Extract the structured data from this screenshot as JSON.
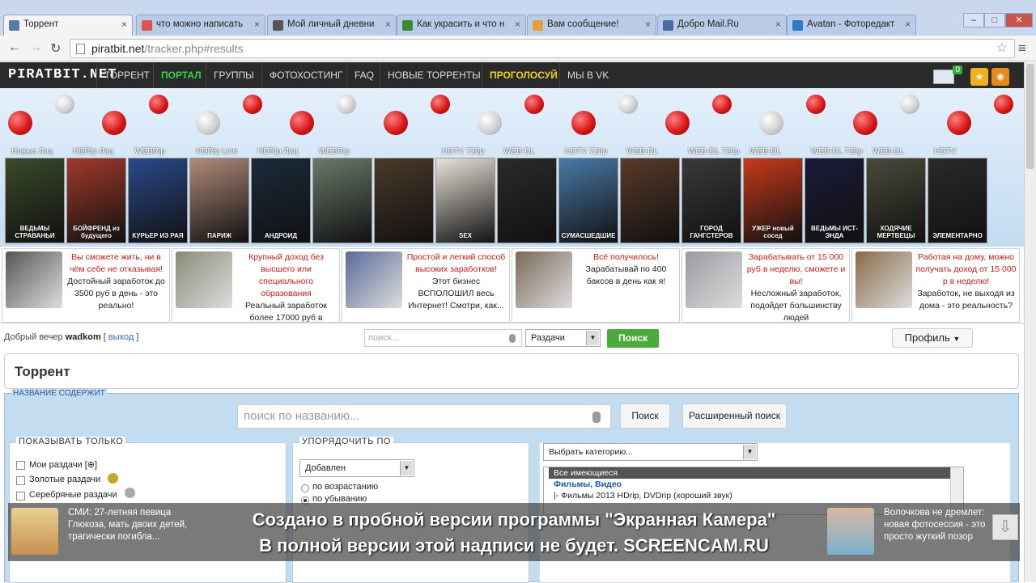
{
  "browser": {
    "tabs": [
      {
        "label": "Торрент",
        "active": true,
        "icon": "piratbit-icon"
      },
      {
        "label": "что можно написать",
        "icon": "yandex-icon"
      },
      {
        "label": "Мой личный дневни",
        "icon": "play-icon"
      },
      {
        "label": "Как украсить и что н",
        "icon": "puzzle-icon"
      },
      {
        "label": "Вам сообщение!",
        "icon": "mail-icon"
      },
      {
        "label": "Добро Mail.Ru",
        "icon": "shield-icon"
      },
      {
        "label": "Avatan - Фоторедакт",
        "icon": "avatan-icon"
      }
    ],
    "url_host": "piratbit.net",
    "url_path": "/tracker.php#results"
  },
  "site_nav": {
    "logo": "PIRATBIT.NET",
    "items": [
      {
        "label": "ТОРРЕНТ",
        "style": "normal"
      },
      {
        "label": "ПОРТАЛ",
        "style": "green"
      },
      {
        "label": "ГРУППЫ",
        "style": "normal"
      },
      {
        "label": "ФОТОХОСТИНГ",
        "style": "normal"
      },
      {
        "label": "FAQ",
        "style": "normal"
      },
      {
        "label": "НОВЫЕ ТОРРЕНТЫ",
        "style": "normal"
      },
      {
        "label": "ПРОГОЛОСУЙ",
        "style": "yellow"
      },
      {
        "label": "МЫ В VK",
        "style": "normal"
      }
    ],
    "mail_count": "0"
  },
  "posters": [
    {
      "label": "Новые Лиц",
      "title": "ВЕДЬМЫ СТРАВАНЬИ",
      "color": "#3a4a2a"
    },
    {
      "label": "HDRip Лиц",
      "title": "БОЙФРЕНД из будущего",
      "color": "#a03a2a"
    },
    {
      "label": "WEBRip",
      "title": "КУРЬЕР ИЗ РАЯ",
      "color": "#2a4a8a"
    },
    {
      "label": "HDRip Line",
      "title": "ПАРИЖ",
      "color": "#b08a7a"
    },
    {
      "label": "HDRip Лиц",
      "title": "АНДРОИД",
      "color": "#1a2a3a"
    },
    {
      "label": "WEBRip",
      "title": "",
      "color": "#6a7a6a"
    },
    {
      "label": "",
      "title": "",
      "color": "#4a3a2a"
    },
    {
      "label": "HDTV 720p",
      "title": "SEX",
      "color": "#e8e2d8"
    },
    {
      "label": "WEB-DL",
      "title": "",
      "color": "#2a2a2a"
    },
    {
      "label": "HDTV 720p",
      "title": "СУМАСШЕДШИЕ",
      "color": "#4a7aa8"
    },
    {
      "label": "WEB-DL",
      "title": "",
      "color": "#5a3a2a"
    },
    {
      "label": "WEB-DL 720p",
      "title": "ГОРОД ГАНГСТЕРОВ",
      "color": "#3a3a3a"
    },
    {
      "label": "WEB-DL",
      "title": "УЖЕР новый сосед",
      "color": "#c83a1a"
    },
    {
      "label": "WEB-DL 720p",
      "title": "ВЕДЬМЫ ИСТ-ЭНДА",
      "color": "#1a1a3a"
    },
    {
      "label": "WEB-DL",
      "title": "ХОДЯЧИЕ МЕРТВЕЦЫ",
      "color": "#4a4a3a"
    },
    {
      "label": "HDTV",
      "title": "ЭЛЕМЕНТАРНО",
      "color": "#2a2a2a"
    }
  ],
  "ads": [
    {
      "headline": "Вы сможете жить, ни в чём себе не отказывая!",
      "body": "Достойный заработок до 3500 руб в день - это реально!",
      "color": "#555"
    },
    {
      "headline": "Крупный доход без высшего или специального образования",
      "body": "Реальный заработок более 17000 руб в неделю!",
      "color": "#8a8a7a"
    },
    {
      "headline": "Простой и легкий способ высоких заработков!",
      "body": "Этот бизнес ВСПОЛОШИЛ весь Интернет! Смотри, как...",
      "color": "#5a6a9a"
    },
    {
      "headline": "Всё получилось!",
      "body": "Зарабатывай по 400 баксов в день как я!",
      "color": "#7a6a5a"
    },
    {
      "headline": "Зарабатывать от 15 000 руб в неделю, сможете и вы!",
      "body": "Несложный заработок, подойдет большинству людей",
      "color": "#9a9aa0"
    },
    {
      "headline": "Работая на дому, можно получать доход от 15 000 р в неделю!",
      "body": "Заработок, не выходя из дома - это реальность?",
      "color": "#8a6a4a"
    }
  ],
  "userbar": {
    "greeting": "Добрый вечер",
    "username": "wadkom",
    "logout": "выход",
    "search_placeholder": "поиск...",
    "select_value": "Раздачи",
    "search_button": "Поиск",
    "profile_button": "Профиль"
  },
  "torrent": {
    "title": "Торрент",
    "name_legend": "НАЗВАНИЕ СОДЕРЖИТ",
    "name_placeholder": "поиск по названию...",
    "search_button": "Поиск",
    "advanced_button": "Расширенный поиск",
    "show_only": {
      "legend": "ПОКАЗЫВАТЬ ТОЛЬКО",
      "options": [
        "Мои раздачи [⊕]",
        "Золотые раздачи",
        "Серебряные раздачи"
      ]
    },
    "sort": {
      "legend": "УПОРЯДОЧИТЬ ПО",
      "select_value": "Добавлен",
      "options": [
        "по возрастанию",
        "по убыванию"
      ],
      "selected": "по убыванию"
    },
    "category": {
      "select_value": "Выбрать категорию...",
      "list": [
        {
          "text": "Все имеющиеся",
          "kind": "hdr"
        },
        {
          "text": "Фильмы, Видео",
          "kind": "grp"
        },
        {
          "text": "|- Фильмы 2013 HDrip, DVDrip (хороший звук)",
          "kind": "item"
        }
      ]
    }
  },
  "overlay": {
    "news_left": "СМИ: 27-летняя певица\nГлюкоза, мать двоих детей,\nтрагически погибла...",
    "news_right": "Волочкова не дремлет:\nновая фотосессия - это\nпросто жуткий позор",
    "watermark_line1": "Создано в пробной версии программы \"Экранная Камера\"",
    "watermark_line2": "В полной версии этой надписи не будет. SCREENCAM.RU"
  }
}
